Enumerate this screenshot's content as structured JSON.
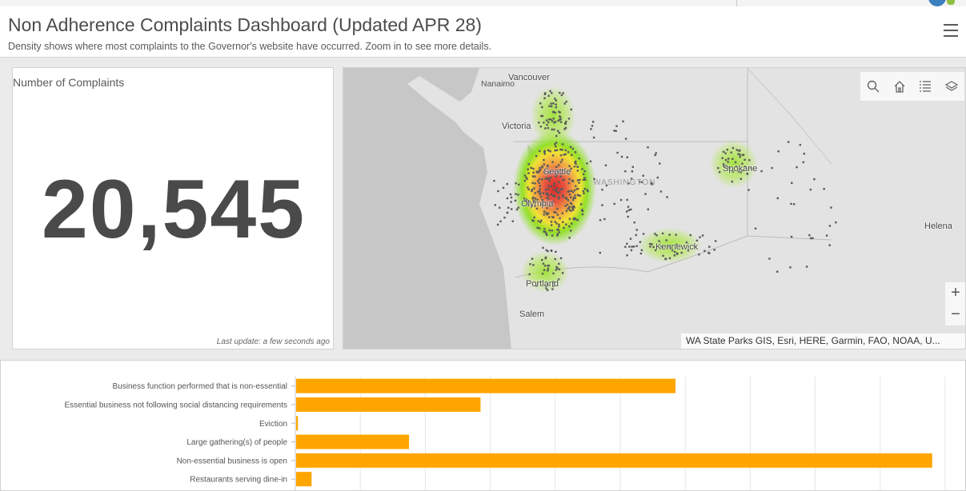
{
  "header": {
    "title": "Non Adherence Complaints Dashboard (Updated APR 28)",
    "subtitle": "Density shows where most complaints to the Governor's website have occurred. Zoom in to see more details."
  },
  "indicator": {
    "label": "Number of Complaints",
    "value": "20,545",
    "last_update": "Last update: a few seconds ago"
  },
  "map": {
    "labels": {
      "vancouver": "Vancouver",
      "nanaimo": "Nanaimo",
      "victoria": "Victoria",
      "seattle": "Seattle",
      "olympia": "Olympia",
      "washington": "WASHINGTON",
      "spokane": "Spokane",
      "kennewick": "Kennewick",
      "portland": "Portland",
      "salem": "Salem",
      "helena": "Helena"
    },
    "attribution": "WA State Parks GIS, Esri, HERE, Garmin, FAO, NOAA, U...",
    "tools": [
      "search-icon",
      "home-icon",
      "legend-icon",
      "layers-icon"
    ],
    "zoom_in": "+",
    "zoom_out": "−"
  },
  "chart_data": {
    "type": "bar",
    "orientation": "horizontal",
    "categories": [
      "Business function performed that is non-essential",
      "Essential business not following social distancing requirements",
      "Eviction",
      "Large gathering(s) of people",
      "Non-essential business is open",
      "Restaurants serving dine-in"
    ],
    "values": [
      5850,
      2850,
      40,
      1750,
      9800,
      250
    ],
    "xlim": [
      0,
      10000
    ],
    "bar_color": "#ffa500",
    "grid": true
  }
}
